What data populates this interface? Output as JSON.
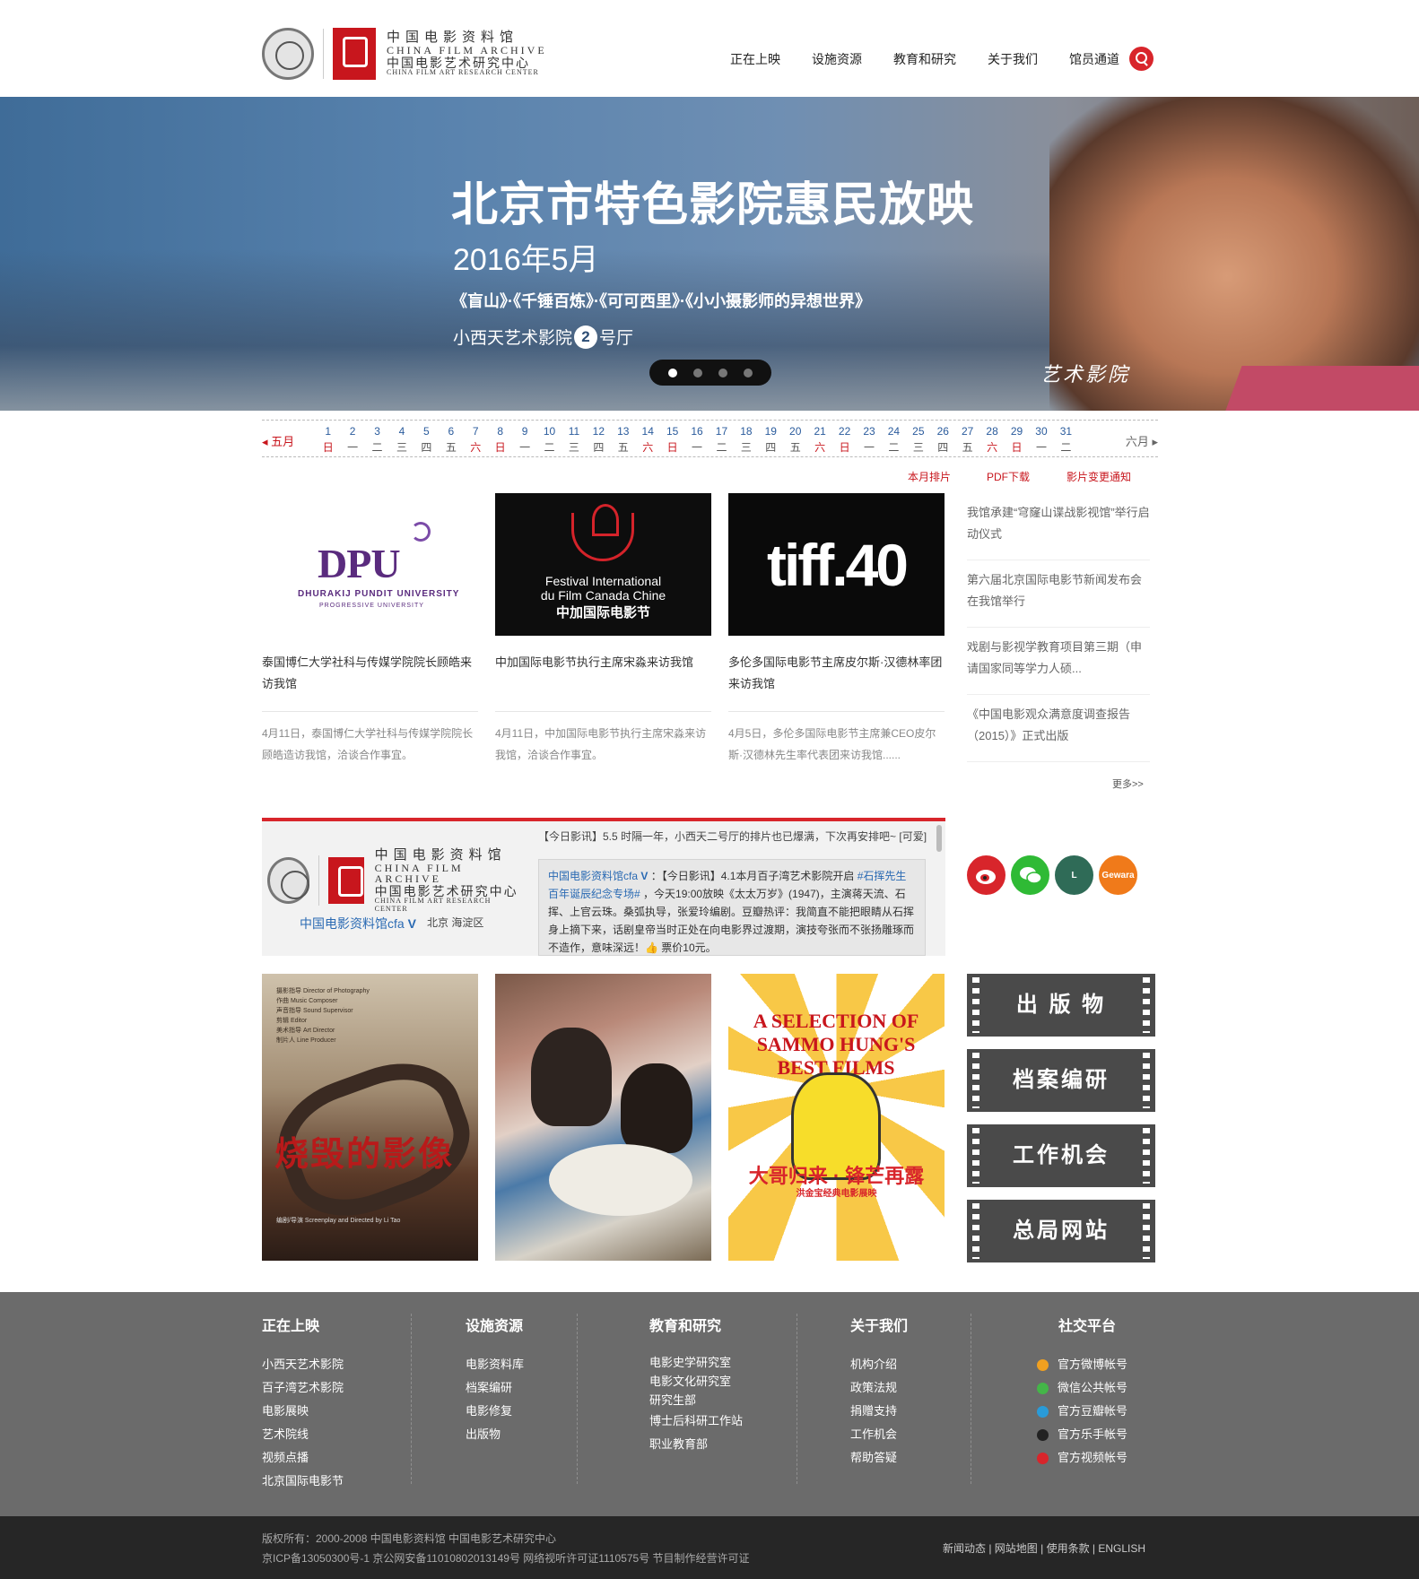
{
  "header": {
    "logo": {
      "cn_name": "中国电影资料馆",
      "en_name": "CHINA FILM ARCHIVE",
      "cn_center": "中国电影艺术研究中心",
      "en_center": "CHINA FILM ART RESEARCH CENTER"
    },
    "nav": [
      "正在上映",
      "设施资源",
      "教育和研究",
      "关于我们",
      "馆员通道"
    ],
    "search_icon": "search-icon",
    "accent_color": "#d8252b"
  },
  "banner": {
    "title": "北京市特色影院惠民放映",
    "date": "2016年5月",
    "films": "《盲山》·《千锤百炼》·《可可西里》·《小小摄影师的异想世界》",
    "venue_pre": "小西天艺术影院",
    "venue_num": "2",
    "venue_post": "号厅",
    "signature": "艺术影院",
    "slides": 4,
    "active_slide": 1
  },
  "calendar": {
    "prev": "五月",
    "next": "六月",
    "days": [
      {
        "n": "1",
        "w": "日"
      },
      {
        "n": "2",
        "w": "一"
      },
      {
        "n": "3",
        "w": "二"
      },
      {
        "n": "4",
        "w": "三"
      },
      {
        "n": "5",
        "w": "四"
      },
      {
        "n": "6",
        "w": "五"
      },
      {
        "n": "7",
        "w": "六"
      },
      {
        "n": "8",
        "w": "日"
      },
      {
        "n": "9",
        "w": "一"
      },
      {
        "n": "10",
        "w": "二"
      },
      {
        "n": "11",
        "w": "三"
      },
      {
        "n": "12",
        "w": "四"
      },
      {
        "n": "13",
        "w": "五"
      },
      {
        "n": "14",
        "w": "六"
      },
      {
        "n": "15",
        "w": "日"
      },
      {
        "n": "16",
        "w": "一"
      },
      {
        "n": "17",
        "w": "二"
      },
      {
        "n": "18",
        "w": "三"
      },
      {
        "n": "19",
        "w": "四"
      },
      {
        "n": "20",
        "w": "五"
      },
      {
        "n": "21",
        "w": "六"
      },
      {
        "n": "22",
        "w": "日"
      },
      {
        "n": "23",
        "w": "一"
      },
      {
        "n": "24",
        "w": "二"
      },
      {
        "n": "25",
        "w": "三"
      },
      {
        "n": "26",
        "w": "四"
      },
      {
        "n": "27",
        "w": "五"
      },
      {
        "n": "28",
        "w": "六"
      },
      {
        "n": "29",
        "w": "日"
      },
      {
        "n": "30",
        "w": "一"
      },
      {
        "n": "31",
        "w": "二"
      }
    ],
    "links": [
      "本月排片",
      "PDF下载",
      "影片变更通知"
    ]
  },
  "news_cards": [
    {
      "logo": {
        "main": "DPU",
        "line1": "DHURAKIJ PUNDIT UNIVERSITY",
        "line2": "PROGRESSIVE UNIVERSITY"
      },
      "title": "泰国博仁大学社科与传媒学院院长顾皓来访我馆",
      "desc": "4月11日，泰国博仁大学社科与传媒学院院长顾皓造访我馆，洽谈合作事宜。"
    },
    {
      "logo": {
        "line1": "Festival International",
        "line2": "du Film Canada Chine",
        "line3": "中加国际电影节"
      },
      "title": "中加国际电影节执行主席宋淼来访我馆",
      "desc": "4月11日，中加国际电影节执行主席宋淼来访我馆，洽谈合作事宜。"
    },
    {
      "logo": {
        "main": "tiff.40"
      },
      "title": "多伦多国际电影节主席皮尔斯·汉德林率团来访我馆",
      "desc": "4月5日，多伦多国际电影节主席兼CEO皮尔斯·汉德林先生率代表团来访我馆......"
    }
  ],
  "news_list": [
    "我馆承建“穹窿山谍战影视馆”举行启动仪式",
    "第六届北京国际电影节新闻发布会在我馆举行",
    "戏剧与影视学教育项目第三期（申请国家同等学力人硕...",
    "《中国电影观众满意度调查报告（2015）》正式出版"
  ],
  "more": "更多>>",
  "weibo": {
    "ticker": "【今日影讯】5.5 时隔一年，小西天二号厅的排片也已爆满，下次再安排吧~ [可爱]",
    "account": "中国电影资料馆cfa",
    "verified": "V",
    "location": "北京 海淀区",
    "feed_user": "中国电影资料馆cfa",
    "feed_pre": "：【今日影讯】4.1本月百子湾艺术影院开启",
    "feed_tag": "#石挥先生百年诞辰纪念专场#",
    "feed_body": "，今天19:00放映《太太万岁》(1947)，主演蒋天流、石挥、上官云珠。桑弧执导，张爱玲编剧。豆瓣热评：我简直不能把眼睛从石挥身上摘下来，话剧皇帝当时正处在向电影界过渡期，演技夸张而不张扬雕琢而不造作，意味深远！👍 票价10元。"
  },
  "social_icons": [
    {
      "icon": "weibo-icon",
      "label": "",
      "color": "#d8252b"
    },
    {
      "icon": "wechat-icon",
      "label": "",
      "color": "#2fba35"
    },
    {
      "icon": "lofter-icon",
      "label": "L",
      "color": "#2f6b57"
    },
    {
      "icon": "guevara-icon",
      "label": "Gewara",
      "color": "#f07a1a"
    }
  ],
  "posters": [
    {
      "title": "烧毁的影像",
      "credit_lines": [
        "摄影指导 Director of Photography",
        "作曲 Music Composer",
        "声音指导 Sound Supervisor",
        "剪辑 Editor",
        "美术指导 Art Director",
        "制片人 Line Producer"
      ],
      "footer": "编剧/导演 Screenplay and Directed by Li Tao"
    },
    {
      "title": ""
    },
    {
      "head": "A SELECTION OF SAMMO HUNG'S BEST FILMS",
      "cn": "大哥归来 · 锋芒再露",
      "sub": "洪金宝经典电影展映"
    }
  ],
  "side_buttons": [
    "出 版 物",
    "档案编研",
    "工作机会",
    "总局网站"
  ],
  "footer": {
    "columns": [
      {
        "head": "正在上映",
        "links": [
          "小西天艺术影院",
          "百子湾艺术影院",
          "电影展映",
          "艺术院线",
          "视频点播",
          "北京国际电影节"
        ]
      },
      {
        "head": "设施资源",
        "links": [
          "电影资料库",
          "档案编研",
          "电影修复",
          "出版物"
        ]
      },
      {
        "head": "教育和研究",
        "links": [
          "电影史学研究室",
          "电影文化研究室",
          "研究生部",
          "博士后科研工作站",
          "职业教育部"
        ]
      },
      {
        "head": "关于我们",
        "links": [
          "机构介绍",
          "政策法规",
          "捐赠支持",
          "工作机会",
          "帮助答疑"
        ]
      }
    ],
    "social": {
      "head": "社交平台",
      "links": [
        {
          "label": "官方微博帐号",
          "color": "#f0a020"
        },
        {
          "label": "微信公共帐号",
          "color": "#44b548"
        },
        {
          "label": "官方豆瓣帐号",
          "color": "#2a9bd8"
        },
        {
          "label": "官方乐手帐号",
          "color": "#222222"
        },
        {
          "label": "官方视频帐号",
          "color": "#d8252b"
        }
      ]
    }
  },
  "bottom": {
    "copyright": "版权所有：2000-2008 中国电影资料馆 中国电影艺术研究中心",
    "icp": "京ICP备13050300号-1 京公网安备11010802013149号 网络视听许可证1110575号 节目制作经营许可证",
    "links": "新闻动态 | 网站地图 | 使用条款 | ENGLISH"
  }
}
